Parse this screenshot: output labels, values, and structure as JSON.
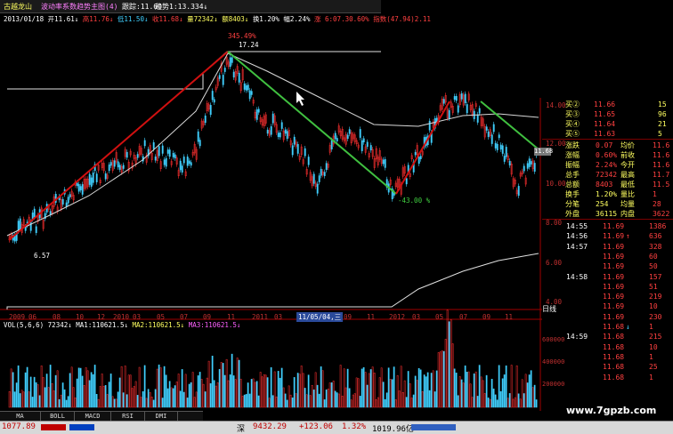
{
  "toolbar": {
    "stock_name": "古越龙山",
    "indicator_name": "波动率系数趋势主图(4)",
    "trend_label": "跟踪:11.60",
    "slope_label": "趋势1:13.334↓"
  },
  "header_line": {
    "date": "2013/01/18",
    "open": "开11.61↓",
    "high": "高11.76↓",
    "low": "低11.50↓",
    "close": "收11.68↓",
    "volume": "量72342↓",
    "amount": "额8403↓",
    "turnover": "换1.20%",
    "change": "幅2.24%",
    "extra": "涨 6:07.30.60%",
    "index": "指数(47.94)2.11"
  },
  "chart_labels": {
    "peak_pct": "345.49%",
    "peak_price": "17.24",
    "low_price": "6.57",
    "drop_pct": "-43.00 %",
    "current_price": "11.68"
  },
  "price_axis": [
    "14.00",
    "12.00",
    "10.00",
    "8.00",
    "6.00",
    "4.00"
  ],
  "time_axis": [
    "2009",
    "06",
    "08",
    "10",
    "12",
    "2010",
    "03",
    "05",
    "07",
    "09",
    "11",
    "2011",
    "03",
    "09",
    "11",
    "2012",
    "03",
    "05",
    "07",
    "09",
    "11"
  ],
  "date_tag": "11/05/04,三",
  "volume_line": {
    "title": "VOL(5,6,6)",
    "vol": "72342↓",
    "ma1": "MA1:110621.5↓",
    "ma2": "MA2:110621.5↓",
    "ma3": "MA3:110621.5↓"
  },
  "volume_axis": [
    "600000",
    "400000",
    "200000"
  ],
  "tabs": [
    "MA",
    "BOLL",
    "MACD",
    "RSI",
    "DMI"
  ],
  "quote": {
    "buy_rows": [
      {
        "label": "买②",
        "price": "11.66",
        "vol": "15"
      },
      {
        "label": "买③",
        "price": "11.65",
        "vol": "96"
      },
      {
        "label": "买④",
        "price": "11.64",
        "vol": "21"
      },
      {
        "label": "买⑤",
        "price": "11.63",
        "vol": "5"
      }
    ],
    "stats": [
      {
        "k1": "涨跌",
        "v1": "0.07",
        "k2": "均价",
        "v2": "11.6"
      },
      {
        "k1": "涨幅",
        "v1": "0.60%",
        "k2": "前收",
        "v2": "11.6"
      },
      {
        "k1": "振幅",
        "v1": "2.24%",
        "k2": "今开",
        "v2": "11.6"
      },
      {
        "k1": "总手",
        "v1": "72342",
        "k2": "最高",
        "v2": "11.7"
      },
      {
        "k1": "总额",
        "v1": "8403",
        "k2": "最低",
        "v2": "11.5"
      },
      {
        "k1": "换手",
        "v1": "1.20%",
        "k2": "量比",
        "v2": "1"
      },
      {
        "k1": "分笔",
        "v1": "254",
        "k2": "均量",
        "v2": "28"
      },
      {
        "k1": "外盘",
        "v1": "36115",
        "k2": "内盘",
        "v2": "3622"
      }
    ],
    "ticks": [
      {
        "time": "14:55",
        "price": "11.69",
        "vol": "1386",
        "arrow": ""
      },
      {
        "time": "14:56",
        "price": "11.69",
        "vol": "636",
        "arrow": "↑"
      },
      {
        "time": "14:57",
        "price": "11.69",
        "vol": "328",
        "arrow": ""
      },
      {
        "time": "",
        "price": "11.69",
        "vol": "60",
        "arrow": ""
      },
      {
        "time": "",
        "price": "11.69",
        "vol": "50",
        "arrow": ""
      },
      {
        "time": "14:58",
        "price": "11.69",
        "vol": "157",
        "arrow": ""
      },
      {
        "time": "",
        "price": "11.69",
        "vol": "51",
        "arrow": ""
      },
      {
        "time": "",
        "price": "11.69",
        "vol": "219",
        "arrow": ""
      },
      {
        "time": "",
        "price": "11.69",
        "vol": "10",
        "arrow": ""
      },
      {
        "time": "",
        "price": "11.69",
        "vol": "230",
        "arrow": ""
      },
      {
        "time": "",
        "price": "11.68",
        "vol": "1",
        "arrow": "↓"
      },
      {
        "time": "14:59",
        "price": "11.68",
        "vol": "215",
        "arrow": ""
      },
      {
        "time": "",
        "price": "11.68",
        "vol": "10",
        "arrow": ""
      },
      {
        "time": "",
        "price": "11.68",
        "vol": "1",
        "arrow": ""
      },
      {
        "time": "",
        "price": "11.68",
        "vol": "25",
        "arrow": ""
      },
      {
        "time": "",
        "price": "11.68",
        "vol": "1",
        "arrow": ""
      }
    ],
    "day_label": "日线"
  },
  "status": {
    "left_index": "1077.89",
    "market": "深",
    "index_value": "9432.29",
    "index_change": "+123.06",
    "index_pct": "1.32%",
    "index_vol": "1019.96亿"
  },
  "watermark": "www.7gpzb.com",
  "colors": {
    "up": "#ff3030",
    "down": "#40d0ff",
    "axis": "#a00000",
    "trend_green": "#40c040",
    "trend_red": "#d01010"
  }
}
